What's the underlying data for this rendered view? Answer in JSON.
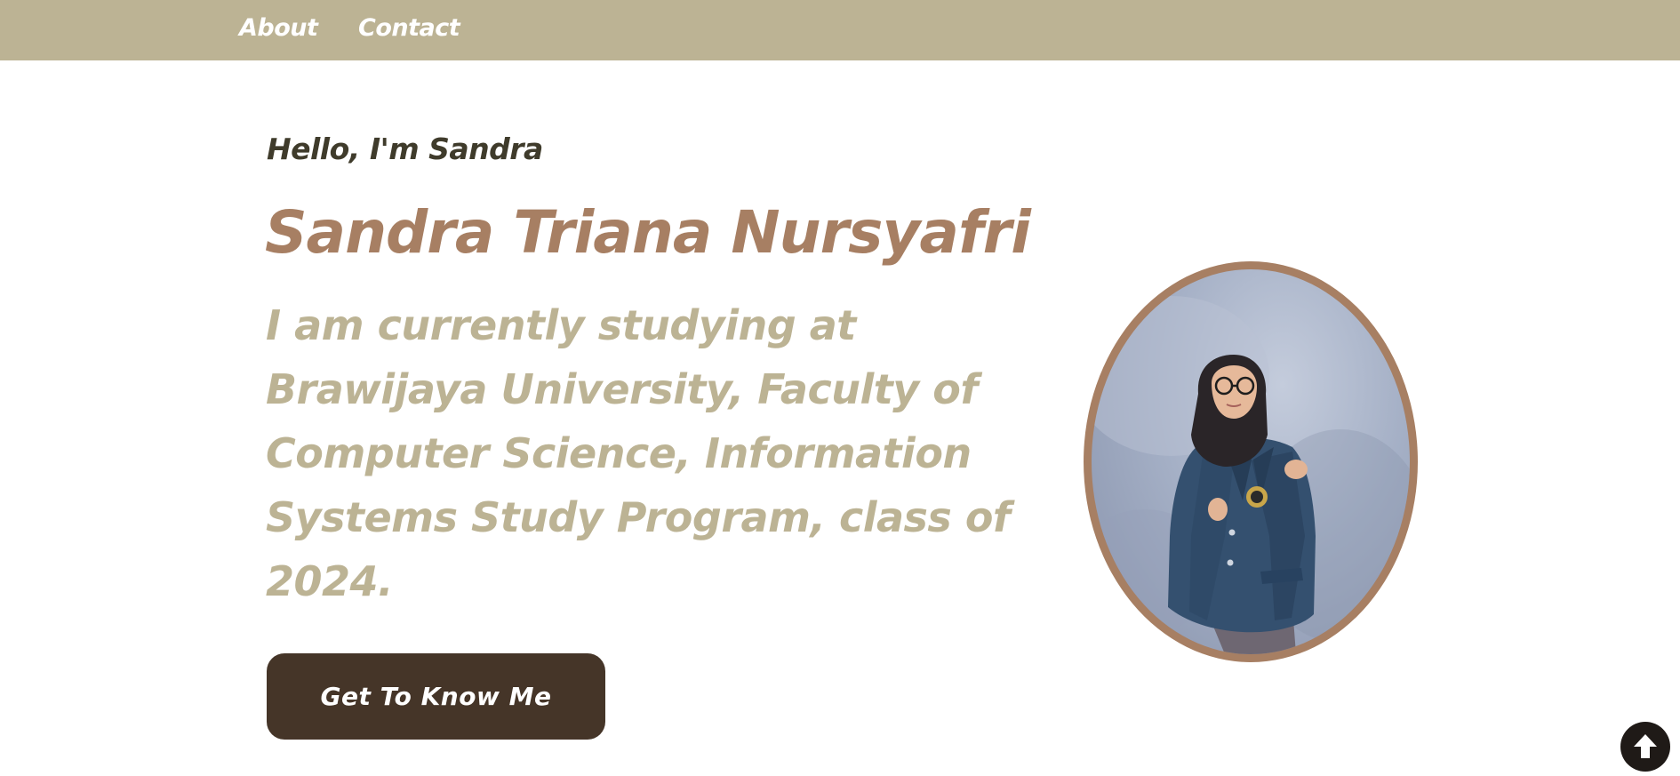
{
  "nav": {
    "items": [
      {
        "label": "About"
      },
      {
        "label": "Contact"
      }
    ]
  },
  "hero": {
    "greeting": "Hello, I'm Sandra",
    "name": "Sandra Triana Nursyafri",
    "bio_lines": [
      "I am currently studying at",
      "Brawijaya University, Faculty of",
      "Computer Science, Information",
      "Systems Study Program, class of",
      "2024."
    ],
    "cta_label": "Get To Know Me"
  },
  "icons": {
    "scroll_top": "arrow-up-circle-icon",
    "portrait": "profile-photo"
  },
  "colors": {
    "nav_bg": "#bcb394",
    "greeting": "#3f3b2b",
    "name": "#a77f63",
    "bio": "#bcb394",
    "button_bg": "#453528",
    "frame": "#a77f63"
  }
}
